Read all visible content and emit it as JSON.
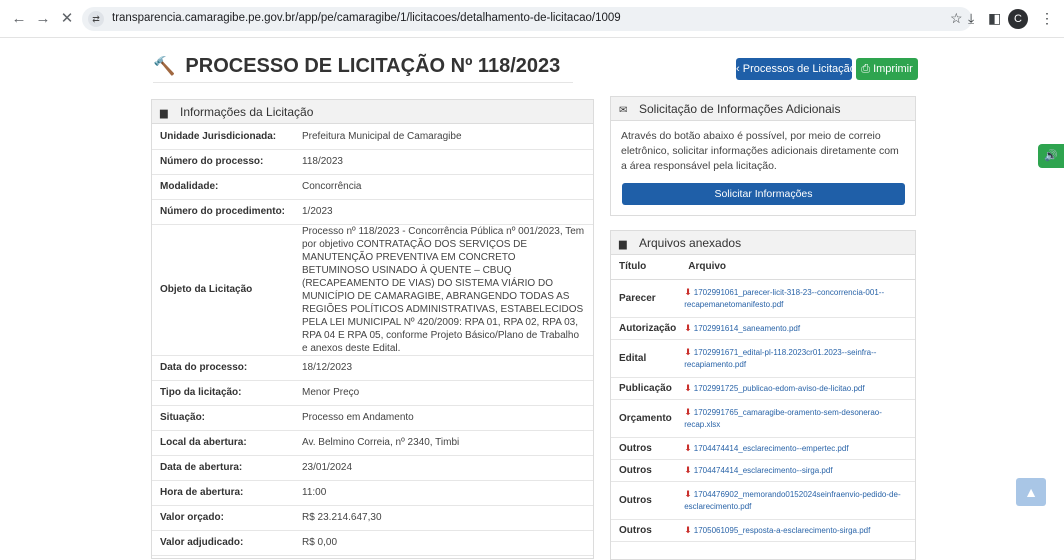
{
  "browser": {
    "url": "transparencia.camaragibe.pe.gov.br/app/pe/camaragibe/1/licitacoes/detalhamento-de-licitacao/1009",
    "avatar_letter": "C"
  },
  "header": {
    "title": "PROCESSO DE LICITAÇÃO Nº 118/2023",
    "back_button": "Processos de Licitação",
    "print_button": "Imprimir"
  },
  "info": {
    "heading": "Informações da Licitação",
    "rows": [
      {
        "label": "Unidade Jurisdicionada:",
        "value": "Prefeitura Municipal de Camaragibe"
      },
      {
        "label": "Número do processo:",
        "value": "118/2023"
      },
      {
        "label": "Modalidade:",
        "value": "Concorrência"
      },
      {
        "label": "Número do procedimento:",
        "value": "1/2023"
      },
      {
        "label": "Objeto da Licitação",
        "value": "Processo nº 118/2023 - Concorrência Pública nº 001/2023, Tem por objetivo CONTRATAÇÃO DOS SERVIÇOS DE MANUTENÇÃO PREVENTIVA EM CONCRETO BETUMINOSO USINADO À QUENTE – CBUQ (RECAPEAMENTO DE VIAS) DO SISTEMA VIÁRIO DO MUNICÍPIO DE CAMARAGIBE, ABRANGENDO TODAS AS REGIÕES POLÍTICOS ADMINISTRATIVAS, ESTABELECIDOS PELA LEI MUNICIPAL Nº 420/2009: RPA 01, RPA 02, RPA 03, RPA 04 E RPA 05, conforme Projeto Básico/Plano de Trabalho e anexos deste Edital."
      },
      {
        "label": "Data do processo:",
        "value": "18/12/2023"
      },
      {
        "label": "Tipo da licitação:",
        "value": "Menor Preço"
      },
      {
        "label": "Situação:",
        "value": "Processo em Andamento"
      },
      {
        "label": "Local da abertura:",
        "value": "Av. Belmino Correia, nº 2340, Timbi"
      },
      {
        "label": "Data de abertura:",
        "value": "23/01/2024"
      },
      {
        "label": "Hora de abertura:",
        "value": "11:00"
      },
      {
        "label": "Valor orçado:",
        "value": "R$ 23.214.647,30"
      },
      {
        "label": "Valor adjudicado:",
        "value": "R$ 0,00"
      }
    ]
  },
  "solicit": {
    "heading": "Solicitação de Informações Adicionais",
    "text": "Através do botão abaixo é possível, por meio de correio eletrônico, solicitar informações adicionais diretamente com a área responsável pela licitação.",
    "button": "Solicitar Informações"
  },
  "files": {
    "heading": "Arquivos anexados",
    "col_title": "Título",
    "col_file": "Arquivo",
    "rows": [
      {
        "type": "Parecer",
        "file": "1702991061_parecer-licit-318-23--concorrencia-001--recapemanetomanifesto.pdf"
      },
      {
        "type": "Autorização",
        "file": "1702991614_saneamento.pdf"
      },
      {
        "type": "Edital",
        "file": "1702991671_edital-pl-118.2023cr01.2023--seinfra--recapiamento.pdf"
      },
      {
        "type": "Publicação",
        "file": "1702991725_publicao-edom-aviso-de-licitao.pdf"
      },
      {
        "type": "Orçamento",
        "file": "1702991765_camaragibe-oramento-sem-desonerao-recap.xlsx"
      },
      {
        "type": "Outros",
        "file": "1704474414_esclarecimento--empertec.pdf"
      },
      {
        "type": "Outros",
        "file": "1704474414_esclarecimento--sirga.pdf"
      },
      {
        "type": "Outros",
        "file": "1704476902_memorando0152024seinfraenvio-pedido-de-esclarecimento.pdf"
      },
      {
        "type": "Outros",
        "file": "1705061095_resposta-a-esclarecimento-sirga.pdf"
      }
    ]
  }
}
